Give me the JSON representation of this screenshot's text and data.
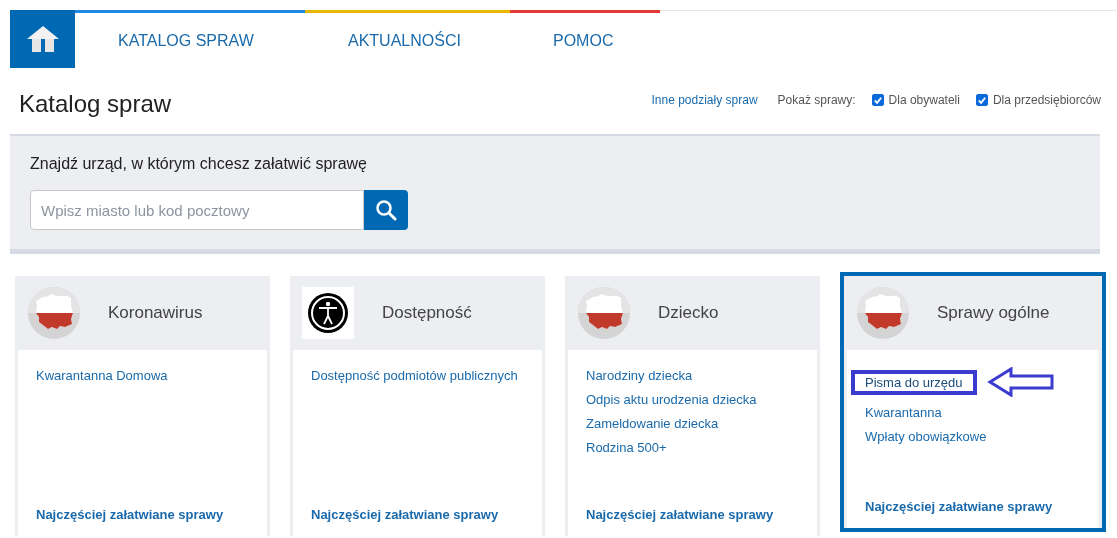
{
  "nav": {
    "items": [
      {
        "label": "KATALOG SPRAW",
        "color": "#1e88e5"
      },
      {
        "label": "AKTUALNOŚCI",
        "color": "#e6b800"
      },
      {
        "label": "POMOC",
        "color": "#e53935"
      }
    ]
  },
  "header": {
    "title": "Katalog spraw",
    "link": "Inne podziały spraw",
    "filter_label": "Pokaż sprawy:",
    "filters": [
      {
        "label": "Dla obywateli",
        "checked": true
      },
      {
        "label": "Dla przedsiębiorców",
        "checked": true
      }
    ]
  },
  "search": {
    "heading": "Znajdź urząd, w którym chcesz załatwić sprawę",
    "placeholder": "Wpisz miasto lub kod pocztowy"
  },
  "cards": [
    {
      "title": "Koronawirus",
      "kind": "map",
      "selected": false,
      "links": [
        {
          "label": "Kwarantanna Domowa",
          "annotated": false
        }
      ],
      "footer": "Najczęściej załatwiane sprawy"
    },
    {
      "title": "Dostępność",
      "kind": "symbol",
      "selected": false,
      "links": [
        {
          "label": "Dostępność podmiotów publicznych",
          "annotated": false
        }
      ],
      "footer": "Najczęściej załatwiane sprawy"
    },
    {
      "title": "Dziecko",
      "kind": "map",
      "selected": false,
      "links": [
        {
          "label": "Narodziny dziecka",
          "annotated": false
        },
        {
          "label": "Odpis aktu urodzenia dziecka",
          "annotated": false
        },
        {
          "label": "Zameldowanie dziecka",
          "annotated": false
        },
        {
          "label": "Rodzina 500+",
          "annotated": false
        }
      ],
      "footer": "Najczęściej załatwiane sprawy"
    },
    {
      "title": "Sprawy ogólne",
      "kind": "map",
      "selected": true,
      "links": [
        {
          "label": "Pisma do urzędu",
          "annotated": true
        },
        {
          "label": "Kwarantanna",
          "annotated": false
        },
        {
          "label": "Wpłaty obowiązkowe",
          "annotated": false
        }
      ],
      "footer": "Najczęściej załatwiane sprawy"
    }
  ]
}
